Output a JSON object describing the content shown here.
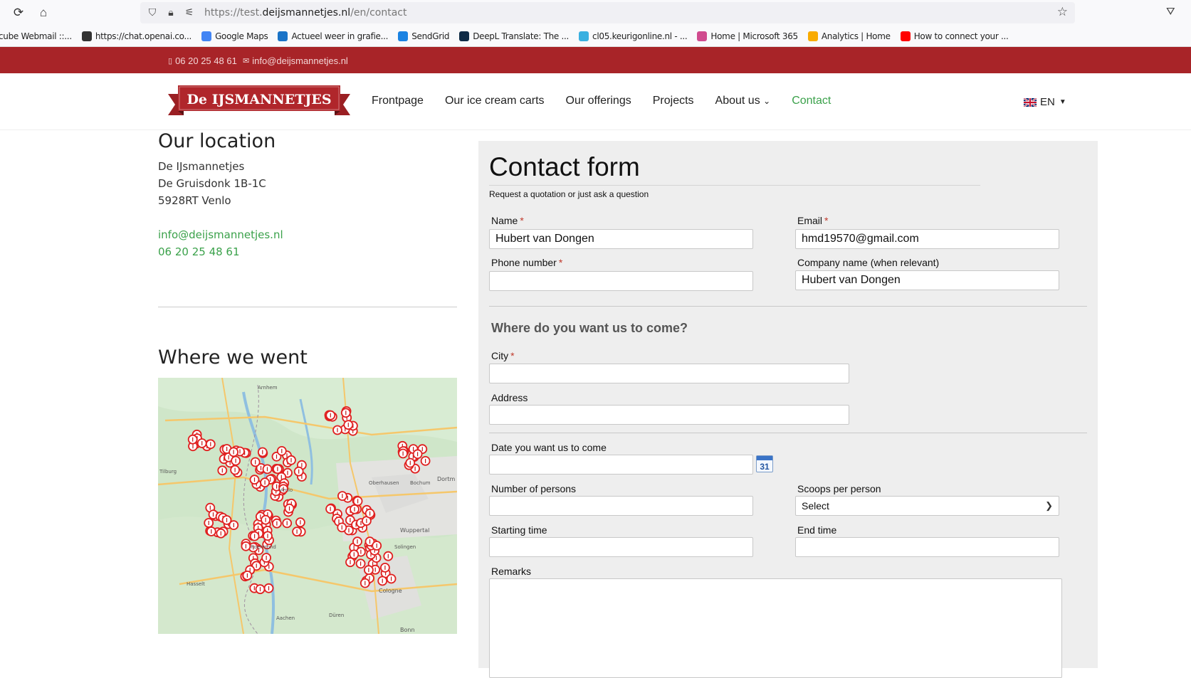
{
  "browser": {
    "url_prefix": "https://test.",
    "url_domain": "deijsmannetjes.nl",
    "url_path": "/en/contact",
    "bookmarks": [
      {
        "label": "cube Webmail ::...",
        "color": "#7a7a7a"
      },
      {
        "label": "https://chat.openai.co...",
        "color": "#333333"
      },
      {
        "label": "Google Maps",
        "color": "#4285f4"
      },
      {
        "label": "Actueel weer in grafie...",
        "color": "#1a73c7"
      },
      {
        "label": "SendGrid",
        "color": "#1a82e2"
      },
      {
        "label": "DeepL Translate: The ...",
        "color": "#0f2b46"
      },
      {
        "label": "cl05.keurigonline.nl - ...",
        "color": "#3ab0e0"
      },
      {
        "label": "Home | Microsoft 365",
        "color": "#d04a8e"
      },
      {
        "label": "Analytics | Home",
        "color": "#f9ab00"
      },
      {
        "label": "How to connect your ...",
        "color": "#ff0000"
      }
    ]
  },
  "topbar": {
    "phone": "06 20 25 48 61",
    "email": "info@deijsmannetjes.nl"
  },
  "logo": {
    "text": "De IJSMANNETJES"
  },
  "nav": {
    "items": [
      "Frontpage",
      "Our ice cream carts",
      "Our offerings",
      "Projects",
      "About us"
    ],
    "active": "Contact",
    "lang": "EN"
  },
  "location": {
    "title": "Our location",
    "name": "De IJsmannetjes",
    "street": "De Gruisdonk 1B-1C",
    "city": "5928RT Venlo",
    "email": "info@deijsmannetjes.nl",
    "phone": "06 20 25 48 61"
  },
  "where": {
    "title": "Where we went",
    "map_labels": [
      "Arnhem",
      "Tilburg",
      "Oberhausen",
      "Bochum",
      "Dortm",
      "Wuppertal",
      "Solingen",
      "Hasselt",
      "Cologne",
      "Bonn",
      "Aachen",
      "Venlo",
      "Düren",
      "Roermond"
    ]
  },
  "form": {
    "title": "Contact form",
    "subtitle": "Request a quotation or just ask a question",
    "name_label": "Name",
    "name_value": "Hubert van Dongen",
    "email_label": "Email",
    "email_value": "hmd19570@gmail.com",
    "phone_label": "Phone number",
    "phone_value": "",
    "company_label": "Company name (when relevant)",
    "company_value": "Hubert van Dongen",
    "section_where": "Where do you want us to come?",
    "city_label": "City",
    "address_label": "Address",
    "date_label": "Date you want us to come",
    "calendar_day": "31",
    "persons_label": "Number of persons",
    "scoops_label": "Scoops per person",
    "scoops_value": "Select",
    "start_label": "Starting time",
    "end_label": "End time",
    "remarks_label": "Remarks",
    "required_mark": "*"
  },
  "colors": {
    "brand_red": "#a82428",
    "accent_green": "#3aa14a",
    "form_bg": "#eeeeee"
  }
}
